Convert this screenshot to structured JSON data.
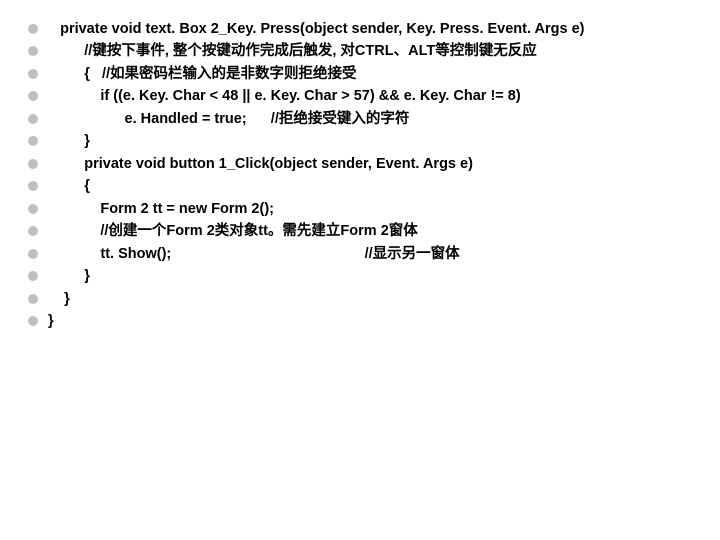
{
  "lines": [
    "   private void text. Box 2_Key. Press(object sender, Key. Press. Event. Args e)",
    "         //键按下事件, 整个按键动作完成后触发, 对CTRL、ALT等控制键无反应",
    "         {   //如果密码栏输入的是非数字则拒绝接受",
    "             if ((e. Key. Char < 48 || e. Key. Char > 57) && e. Key. Char != 8)",
    "                   e. Handled = true;      //拒绝接受键入的字符",
    "         }",
    "         private void button 1_Click(object sender, Event. Args e)",
    "         {",
    "             Form 2 tt = new Form 2();",
    "             //创建一个Form 2类对象tt。需先建立Form 2窗体",
    "             tt. Show();                                                //显示另一窗体",
    "         }",
    "    }",
    "}"
  ]
}
